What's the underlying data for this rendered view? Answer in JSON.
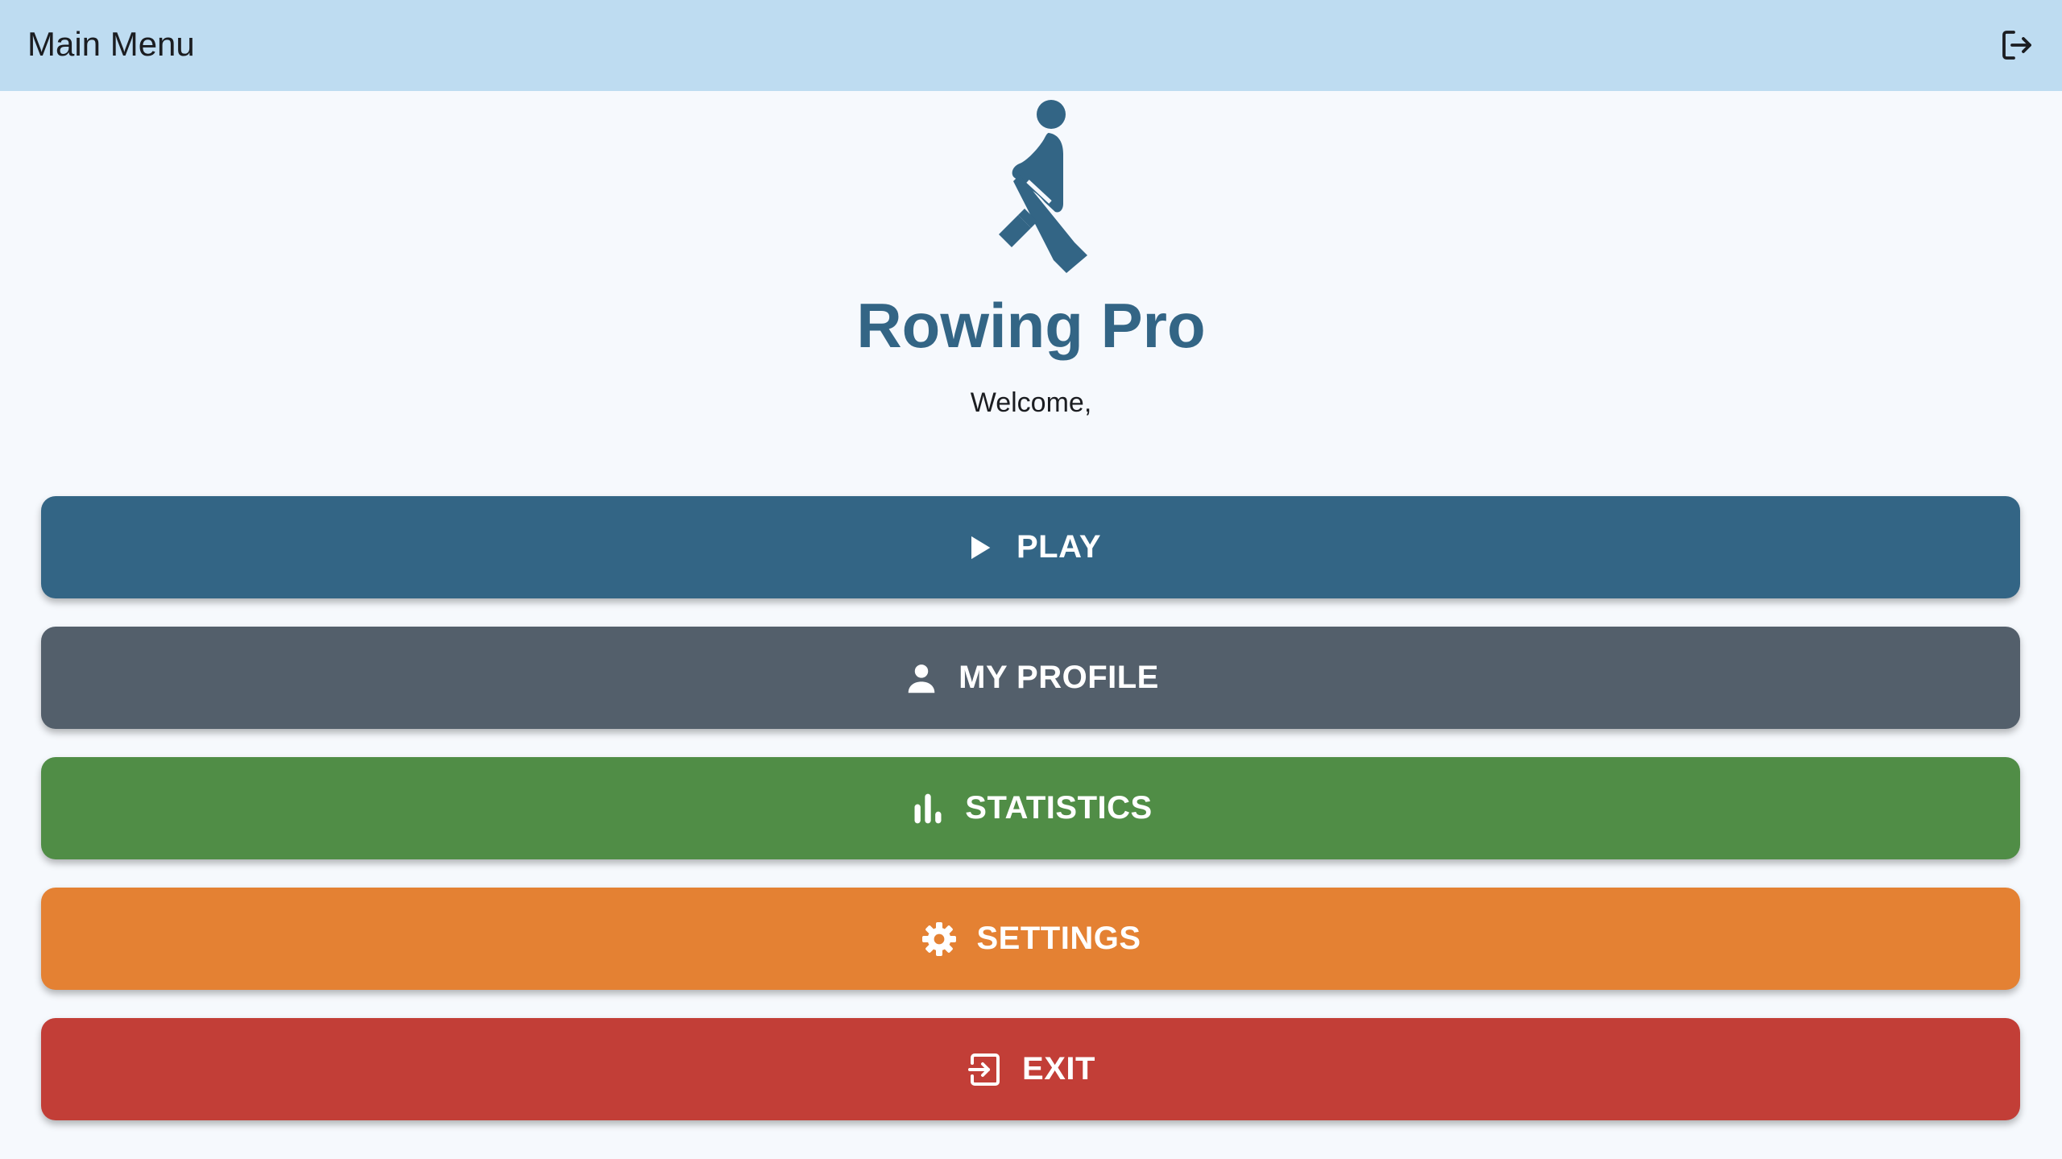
{
  "app_bar": {
    "title": "Main Menu",
    "logout_icon": "logout-icon"
  },
  "hero": {
    "logo_icon": "rowing-icon",
    "app_name": "Rowing Pro",
    "welcome_text": "Welcome,"
  },
  "menu": {
    "items": [
      {
        "label": "PLAY",
        "icon": "play-icon",
        "color": "#336585"
      },
      {
        "label": "MY PROFILE",
        "icon": "person-icon",
        "color": "#535f6b"
      },
      {
        "label": "STATISTICS",
        "icon": "bar-chart-icon",
        "color": "#508d46"
      },
      {
        "label": "SETTINGS",
        "icon": "gear-icon",
        "color": "#e48133"
      },
      {
        "label": "EXIT",
        "icon": "exit-icon",
        "color": "#c23e37"
      }
    ]
  },
  "colors": {
    "app_bar_bg": "#bedcf1",
    "page_bg": "#f6f9fd",
    "brand": "#336585"
  }
}
